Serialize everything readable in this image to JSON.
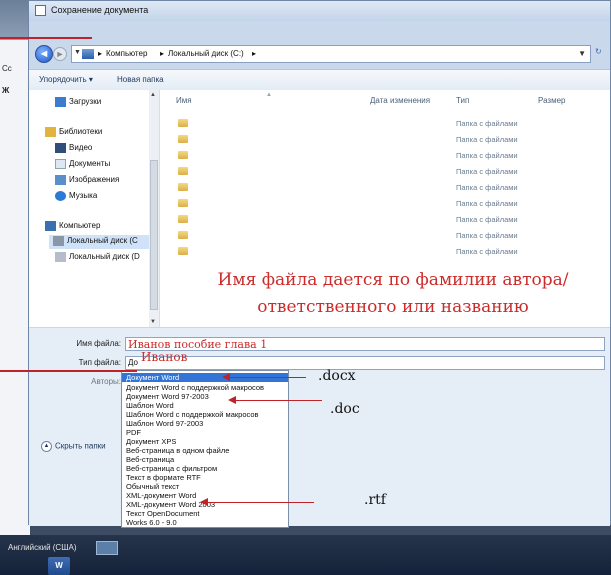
{
  "window": {
    "title": "Сохранение документа"
  },
  "background": {
    "fragments": [
      "Сс",
      "Ж"
    ],
    "language": "Английский (США)",
    "word_icon": "W"
  },
  "address": {
    "crumbs": [
      "Компьютер",
      "Локальный диск (C:)"
    ],
    "separator": "▸"
  },
  "commands": {
    "organize": "Упорядочить ▾",
    "new_folder": "Новая папка"
  },
  "nav": {
    "items": [
      {
        "label": "Загрузки",
        "icon": "downloads-icon"
      },
      {
        "label": "Библиотеки",
        "icon": "libraries-icon"
      },
      {
        "label": "Видео",
        "icon": "video-icon"
      },
      {
        "label": "Документы",
        "icon": "documents-icon"
      },
      {
        "label": "Изображения",
        "icon": "pictures-icon"
      },
      {
        "label": "Музыка",
        "icon": "music-icon"
      },
      {
        "label": "Компьютер",
        "icon": "computer-icon"
      },
      {
        "label": "Локальный диск (С",
        "icon": "local-disk-icon"
      },
      {
        "label": "Локальный диск (D",
        "icon": "local-disk-icon"
      }
    ]
  },
  "columns": {
    "name": "Имя",
    "date": "Дата изменения",
    "type": "Тип",
    "size": "Размер"
  },
  "files": {
    "type": "Папка с файлами"
  },
  "annotation": {
    "line1": "Имя файла дается по фамилии автора/",
    "line2": "ответственного или названию"
  },
  "form": {
    "filename_label": "Имя файла:",
    "filename_value": "Иванов пособие глава 1",
    "filetype_label": "Тип файла:",
    "filetype_value": "До",
    "authors_label": "Авторы:",
    "author_note": "Иванов",
    "hide_folders": "Скрыть папки"
  },
  "filetypes": [
    "Документ Word",
    "Документ Word с поддержкой макросов",
    "Документ Word 97-2003",
    "Шаблон Word",
    "Шаблон Word с поддержкой макросов",
    "Шаблон Word 97-2003",
    "PDF",
    "Документ XPS",
    "Веб-страница в одном файле",
    "Веб-страница",
    "Веб-страница с фильтром",
    "Текст в формате RTF",
    "Обычный текст",
    "XML-документ Word",
    "XML-документ Word 2003",
    "Текст OpenDocument",
    "Works 6.0 - 9.0"
  ],
  "extensions": {
    "docx": ".docx",
    "doc": ".doc",
    "rtf": ".rtf"
  },
  "colors": {
    "annotation_red": "#cc2b2b",
    "selection_blue": "#3375d6"
  }
}
